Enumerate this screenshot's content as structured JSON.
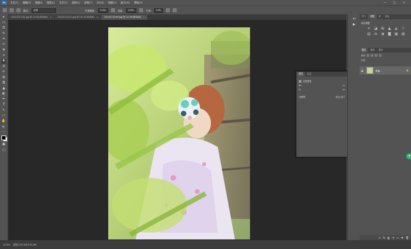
{
  "menubar": {
    "logo": "Ps",
    "items": [
      "文件(F)",
      "编辑(E)",
      "图像(I)",
      "图层(L)",
      "文字(Y)",
      "选择(S)",
      "滤镜(T)",
      "3D(D)",
      "视图(V)",
      "窗口(W)",
      "帮助(H)"
    ],
    "minimize": "—",
    "maximize": "□",
    "close": "×"
  },
  "options": {
    "mode_label": "模式:",
    "mode_value": "正常",
    "opacity_label": "不透明度:",
    "opacity_value": "100%",
    "flow_label": "流量:",
    "flow_value": "100%",
    "smoothing_label": "平滑:",
    "smoothing_value": "10%"
  },
  "tabs": [
    {
      "label": "20210713-01.jpg @ 12.5%(RGB/8)",
      "close": "×"
    },
    {
      "label": "20210713-07.jpg @ 16.7%(RGB/8)",
      "close": "×"
    },
    {
      "label": "20210713-09.jpg @ 12.5%(RGB/8)",
      "close": "×"
    }
  ],
  "tools": [
    "▸",
    "▭",
    "ʘ",
    "✎",
    "⌗",
    "✂",
    "⊕",
    "⌖",
    "✚",
    "⊘",
    "✐",
    "◍",
    "⧉",
    "▲",
    "◐",
    "✒",
    "T",
    "↖",
    "▭",
    "✋",
    "🔍",
    "⋯",
    "▣",
    "▢"
  ],
  "panels": {
    "top_tabs": [
      "学习",
      "调整",
      "库",
      "色板"
    ],
    "adjust_title": "添加调整",
    "adjust_icons": [
      "☼",
      "◪",
      "⊞",
      "▲",
      "◭",
      "▽",
      "▤",
      "⚖",
      "◑",
      "◙",
      "▦",
      "▨"
    ],
    "layer_tabs": [
      "图层",
      "通道",
      "路径"
    ],
    "filter_label": "类型",
    "blend_mode": "正常",
    "layer_name": "背景",
    "footer_icons": [
      "⊝",
      "fx",
      "◧",
      "◔",
      "▭",
      "✚",
      "🗑"
    ]
  },
  "properties": {
    "tabs": [
      "属性",
      "信息"
    ],
    "title": "文档属性",
    "rows": [
      {
        "label": "W:",
        "value": "px"
      },
      {
        "label": "H:",
        "value": "px"
      },
      {
        "label": "分辨率:",
        "value": "像素/英寸"
      }
    ]
  },
  "status": {
    "zoom": "12.5%",
    "doc": "文档:125.2M/125.2M"
  },
  "colors": {
    "accent": "#27b86a",
    "workspace": "#282828",
    "panel": "#535353"
  }
}
